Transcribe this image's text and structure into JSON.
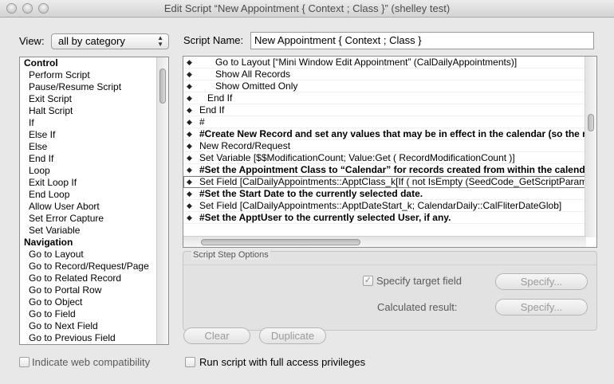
{
  "window": {
    "title": "Edit Script “New Appointment { Context ; Class }” (shelley test)"
  },
  "view": {
    "label": "View:",
    "selected": "all by category"
  },
  "steps": [
    {
      "label": "Control",
      "category": true
    },
    {
      "label": "Perform Script"
    },
    {
      "label": "Pause/Resume Script"
    },
    {
      "label": "Exit Script"
    },
    {
      "label": "Halt Script"
    },
    {
      "label": "If"
    },
    {
      "label": "Else If"
    },
    {
      "label": "Else"
    },
    {
      "label": "End If"
    },
    {
      "label": "Loop"
    },
    {
      "label": "Exit Loop If"
    },
    {
      "label": "End Loop"
    },
    {
      "label": "Allow User Abort"
    },
    {
      "label": "Set Error Capture"
    },
    {
      "label": "Set Variable"
    },
    {
      "label": "Navigation",
      "category": true
    },
    {
      "label": "Go to Layout"
    },
    {
      "label": "Go to Record/Request/Page"
    },
    {
      "label": "Go to Related Record"
    },
    {
      "label": "Go to Portal Row"
    },
    {
      "label": "Go to Object"
    },
    {
      "label": "Go to Field"
    },
    {
      "label": "Go to Next Field"
    },
    {
      "label": "Go to Previous Field"
    }
  ],
  "script_name": {
    "label": "Script Name:",
    "value": "New Appointment { Context ; Class }"
  },
  "script_lines": [
    {
      "text": "Go to Layout [“Mini Window Edit Appointment” (CalDailyAppointments)]",
      "indent": 3
    },
    {
      "text": "Show All Records",
      "indent": 3
    },
    {
      "text": "Show Omitted Only",
      "indent": 3
    },
    {
      "text": "End If",
      "indent": 2
    },
    {
      "text": "End If",
      "indent": 1
    },
    {
      "text": "#",
      "indent": 1
    },
    {
      "text": "#Create New Record and set any values that may be in effect in the calendar (so the r",
      "indent": 1,
      "bold": true
    },
    {
      "text": "New Record/Request",
      "indent": 1
    },
    {
      "text": "Set Variable [$$ModificationCount; Value:Get ( RecordModificationCount )]",
      "indent": 1
    },
    {
      "text": "#Set the Appointment Class to “Calendar” for records created from within the calenda",
      "indent": 1,
      "bold": true
    },
    {
      "text": "Set Field [CalDailyAppointments::ApptClass_k[If ( not IsEmpty (SeedCode_GetScriptParamet",
      "indent": 1,
      "selected": true
    },
    {
      "text": "#Set the Start Date to the currently selected date.",
      "indent": 1,
      "bold": true
    },
    {
      "text": "Set Field [CalDailyAppointments::ApptDateStart_k; CalendarDaily::CalFliterDateGlob]",
      "indent": 1
    },
    {
      "text": "#Set the ApptUser to the currently selected User, if any.",
      "indent": 1,
      "bold": true
    }
  ],
  "options": {
    "legend": "Script Step Options",
    "specify_target_label": "Specify target field",
    "specify_target_checked": true,
    "specify_button_1": "Specify...",
    "calculated_result_label": "Calculated result:",
    "specify_button_2": "Specify..."
  },
  "buttons": {
    "clear": "Clear",
    "duplicate": "Duplicate"
  },
  "footer": {
    "web_compat_label": "Indicate web compatibility",
    "full_access_label": "Run script with full access privileges"
  },
  "glyphs": {
    "diamond": "◆",
    "check": "✓",
    "select_arrows": "▲▼"
  }
}
